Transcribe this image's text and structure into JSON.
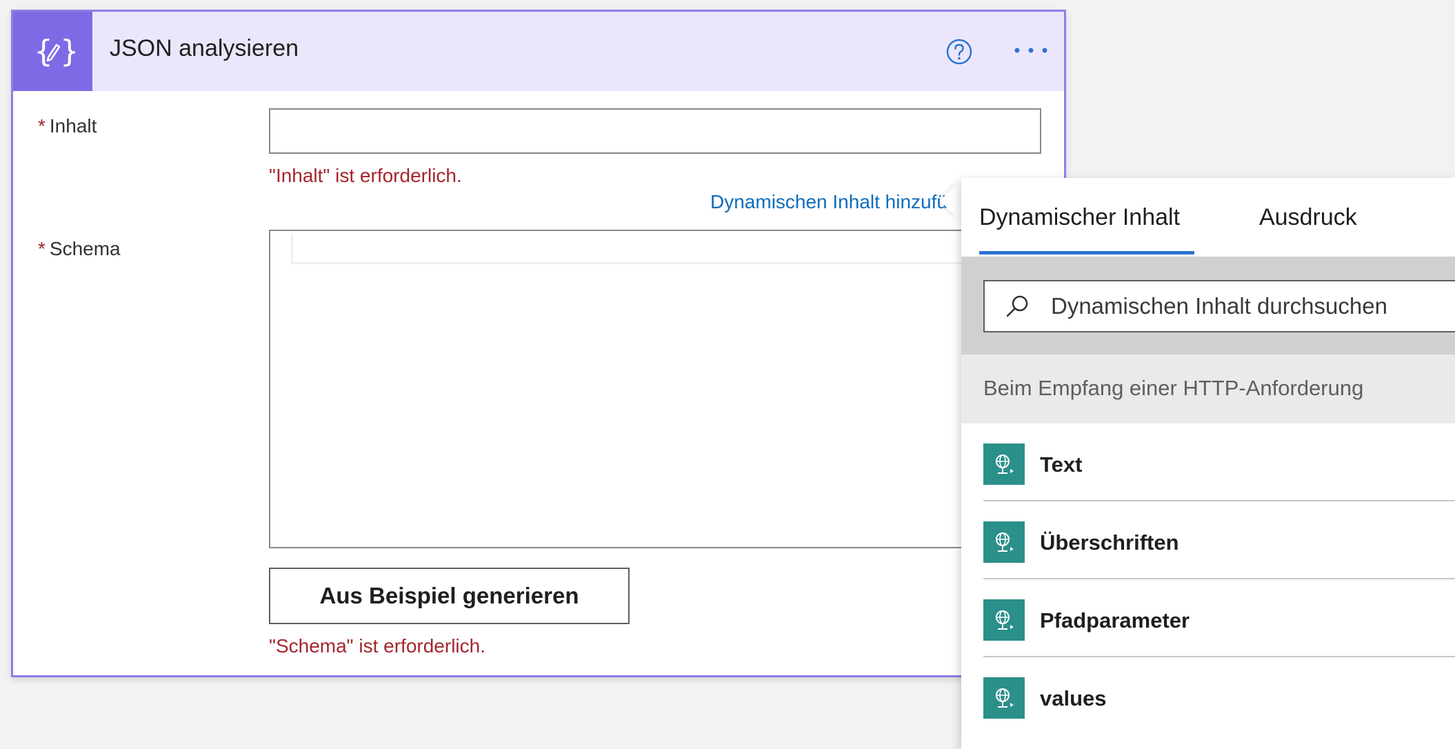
{
  "action_card": {
    "title": "JSON analysieren",
    "icon": "json-edit-icon",
    "help_icon": "question-circle-icon",
    "more_icon": "ellipsis-icon",
    "accent_color": "#7f6ae5",
    "fields": {
      "inhalt": {
        "required_marker": "*",
        "label": "Inhalt",
        "value": "",
        "error": "\"Inhalt\" ist erforderlich."
      },
      "schema": {
        "required_marker": "*",
        "label": "Schema",
        "value": "",
        "error": "\"Schema\" ist erforderlich."
      }
    },
    "add_dynamic_link": "Dynamischen Inhalt hinzufü",
    "generate_button": "Aus Beispiel generieren"
  },
  "dynamic_panel": {
    "tabs": [
      {
        "label": "Dynamischer Inhalt",
        "active": true
      },
      {
        "label": "Ausdruck",
        "active": false
      }
    ],
    "search": {
      "placeholder": "Dynamischen Inhalt durchsuchen",
      "value": "",
      "icon": "search-icon"
    },
    "section_title": "Beim Empfang einer HTTP-Anforderung",
    "items": [
      {
        "label": "Text",
        "icon": "http-request-icon"
      },
      {
        "label": "Überschriften",
        "icon": "http-request-icon"
      },
      {
        "label": "Pfadparameter",
        "icon": "http-request-icon"
      },
      {
        "label": "values",
        "icon": "http-request-icon"
      }
    ],
    "item_icon_color": "#2b8f8a"
  }
}
